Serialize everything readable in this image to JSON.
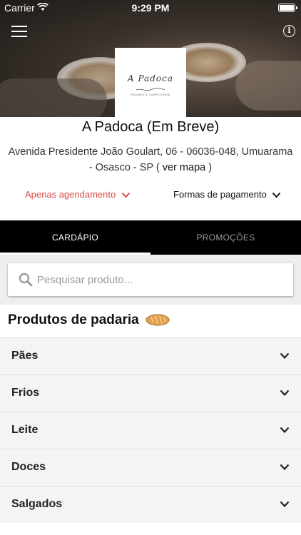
{
  "status_bar": {
    "carrier": "Carrier",
    "time": "9:29 PM"
  },
  "header": {
    "logo_text": "A Padoca",
    "logo_tagline": "PADARIA & CONFEITARIA",
    "menu_icon": "hamburger-menu-icon",
    "info_icon": "info-icon"
  },
  "store": {
    "title": "A Padoca (Em Breve)",
    "address": "Avenida Presidente João Goulart, 06 - 06036-048, Umuarama - Osasco - SP (",
    "map_link": "ver mapa",
    "address_end": ")"
  },
  "options": {
    "schedule_label": "Apenas agendamento",
    "payment_label": "Formas de pagamento",
    "schedule_color": "#d94a4a"
  },
  "tabs": [
    {
      "label": "CARDÁPIO",
      "active": true
    },
    {
      "label": "PROMOÇÕES",
      "active": false
    }
  ],
  "search": {
    "placeholder": "Pesquisar produto..."
  },
  "section": {
    "title": "Produtos de padaria",
    "icon": "bread-icon"
  },
  "categories": [
    {
      "label": "Pães"
    },
    {
      "label": "Frios"
    },
    {
      "label": "Leite"
    },
    {
      "label": "Doces"
    },
    {
      "label": "Salgados"
    }
  ]
}
